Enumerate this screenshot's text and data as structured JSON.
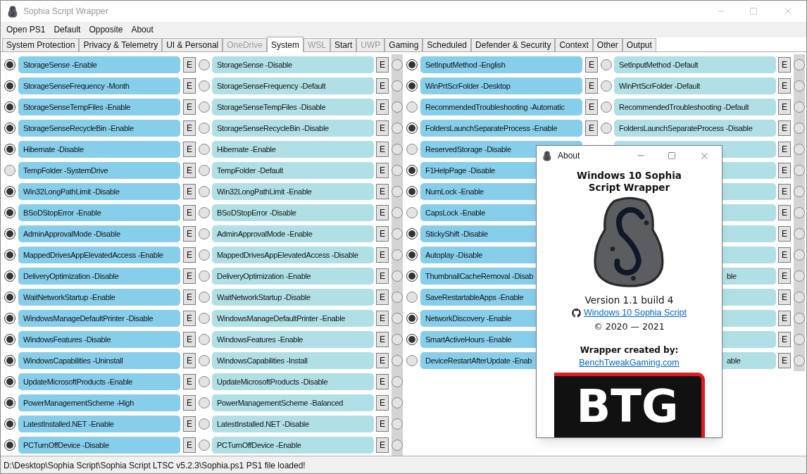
{
  "window": {
    "title": "Sophia Script Wrapper"
  },
  "menu": [
    "Open PS1",
    "Default",
    "Opposite",
    "About"
  ],
  "tabs": [
    {
      "label": "System Protection",
      "selected": false,
      "disabled": false
    },
    {
      "label": "Privacy & Telemetry",
      "selected": false,
      "disabled": false
    },
    {
      "label": "UI & Personal",
      "selected": false,
      "disabled": false
    },
    {
      "label": "OneDrive",
      "selected": false,
      "disabled": true
    },
    {
      "label": "System",
      "selected": true,
      "disabled": false
    },
    {
      "label": "WSL",
      "selected": false,
      "disabled": true
    },
    {
      "label": "Start",
      "selected": false,
      "disabled": false
    },
    {
      "label": "UWP",
      "selected": false,
      "disabled": true
    },
    {
      "label": "Gaming",
      "selected": false,
      "disabled": false
    },
    {
      "label": "Scheduled",
      "selected": false,
      "disabled": false
    },
    {
      "label": "Defender & Security",
      "selected": false,
      "disabled": false
    },
    {
      "label": "Context",
      "selected": false,
      "disabled": false
    },
    {
      "label": "Other",
      "selected": false,
      "disabled": false
    },
    {
      "label": "Output",
      "selected": false,
      "disabled": false
    }
  ],
  "rows_left": [
    {
      "option": {
        "label": "StorageSense -Enable",
        "selected": true,
        "edit": "E"
      },
      "opposite": {
        "label": "StorageSense -Disable",
        "selected": false,
        "edit": "E"
      },
      "extra": {
        "selected": false
      }
    },
    {
      "option": {
        "label": "StorageSenseFrequency -Month",
        "selected": true,
        "edit": "E"
      },
      "opposite": {
        "label": "StorageSenseFrequency -Default",
        "selected": false,
        "edit": "E"
      },
      "extra": {
        "selected": false
      }
    },
    {
      "option": {
        "label": "StorageSenseTempFiles -Enable",
        "selected": true,
        "edit": "E"
      },
      "opposite": {
        "label": "StorageSenseTempFiles -Disable",
        "selected": false,
        "edit": "E"
      },
      "extra": {
        "selected": false
      }
    },
    {
      "option": {
        "label": "StorageSenseRecycleBin -Enable",
        "selected": true,
        "edit": "E"
      },
      "opposite": {
        "label": "StorageSenseRecycleBin -Disable",
        "selected": false,
        "edit": "E"
      },
      "extra": {
        "selected": false
      }
    },
    {
      "option": {
        "label": "Hibernate -Disable",
        "selected": true,
        "edit": "E"
      },
      "opposite": {
        "label": "Hibernate -Enable",
        "selected": false,
        "edit": "E"
      },
      "extra": {
        "selected": false
      }
    },
    {
      "option": {
        "label": "TempFolder -SystemDrive",
        "selected": false,
        "edit": "E"
      },
      "opposite": {
        "label": "TempFolder -Default",
        "selected": false,
        "edit": "E"
      },
      "extra": {
        "selected": false
      }
    },
    {
      "option": {
        "label": "Win32LongPathLimit -Disable",
        "selected": true,
        "edit": "E"
      },
      "opposite": {
        "label": "Win32LongPathLimit -Enable",
        "selected": false,
        "edit": "E"
      },
      "extra": {
        "selected": false
      }
    },
    {
      "option": {
        "label": "BSoDStopError -Enable",
        "selected": true,
        "edit": "E"
      },
      "opposite": {
        "label": "BSoDStopError -Disable",
        "selected": false,
        "edit": "E"
      },
      "extra": {
        "selected": false
      }
    },
    {
      "option": {
        "label": "AdminApprovalMode -Disable",
        "selected": true,
        "edit": "E"
      },
      "opposite": {
        "label": "AdminApprovalMode -Enable",
        "selected": false,
        "edit": "E"
      },
      "extra": {
        "selected": false
      }
    },
    {
      "option": {
        "label": "MappedDrivesAppElevatedAccess -Enable",
        "selected": true,
        "edit": "E"
      },
      "opposite": {
        "label": "MappedDrivesAppElevatedAccess -Disable",
        "selected": false,
        "edit": "E"
      },
      "extra": {
        "selected": false
      }
    },
    {
      "option": {
        "label": "DeliveryOptimization -Disable",
        "selected": true,
        "edit": "E"
      },
      "opposite": {
        "label": "DeliveryOptimization -Enable",
        "selected": false,
        "edit": "E"
      },
      "extra": {
        "selected": false
      }
    },
    {
      "option": {
        "label": "WaitNetworkStartup -Enable",
        "selected": true,
        "edit": "E"
      },
      "opposite": {
        "label": "WaitNetworkStartup -Disable",
        "selected": false,
        "edit": "E"
      },
      "extra": {
        "selected": false
      }
    },
    {
      "option": {
        "label": "WindowsManageDefaultPrinter -Disable",
        "selected": true,
        "edit": "E"
      },
      "opposite": {
        "label": "WindowsManageDefaultPrinter -Enable",
        "selected": false,
        "edit": "E"
      },
      "extra": {
        "selected": false
      }
    },
    {
      "option": {
        "label": "WindowsFeatures -Disable",
        "selected": true,
        "edit": "E"
      },
      "opposite": {
        "label": "WindowsFeatures -Enable",
        "selected": false,
        "edit": "E"
      },
      "extra": {
        "selected": false
      }
    },
    {
      "option": {
        "label": "WindowsCapabilities -Uninstall",
        "selected": true,
        "edit": "E"
      },
      "opposite": {
        "label": "WindowsCapabilities -Install",
        "selected": false,
        "edit": "E"
      },
      "extra": {
        "selected": false
      }
    },
    {
      "option": {
        "label": "UpdateMicrosoftProducts -Enable",
        "selected": true,
        "edit": "E"
      },
      "opposite": {
        "label": "UpdateMicrosoftProducts -Disable",
        "selected": false,
        "edit": "E"
      },
      "extra": {
        "selected": false
      }
    },
    {
      "option": {
        "label": "PowerManagementScheme -High",
        "selected": true,
        "edit": "E"
      },
      "opposite": {
        "label": "PowerManagementScheme -Balanced",
        "selected": false,
        "edit": "E"
      },
      "extra": {
        "selected": false
      }
    },
    {
      "option": {
        "label": "LatestInstalled.NET -Enable",
        "selected": true,
        "edit": "E"
      },
      "opposite": {
        "label": "LatestInstalled.NET -Disable",
        "selected": false,
        "edit": "E"
      },
      "extra": {
        "selected": false
      }
    },
    {
      "option": {
        "label": "PCTurnOffDevice -Disable",
        "selected": true,
        "edit": "E"
      },
      "opposite": {
        "label": "PCTurnOffDevice -Enable",
        "selected": false,
        "edit": "E"
      },
      "extra": {
        "selected": false
      }
    }
  ],
  "rows_right": [
    {
      "option": {
        "label": "SetInputMethod -English",
        "selected": true,
        "edit": "E"
      },
      "opposite": {
        "label": "SetInputMethod -Default",
        "selected": false,
        "edit": "E"
      },
      "extra": {
        "selected": false
      }
    },
    {
      "option": {
        "label": "WinPrtScrFolder -Desktop",
        "selected": true,
        "edit": "E"
      },
      "opposite": {
        "label": "WinPrtScrFolder -Default",
        "selected": false,
        "edit": "E"
      },
      "extra": {
        "selected": false
      }
    },
    {
      "option": {
        "label": "RecommendedTroubleshooting -Automatic",
        "selected": false,
        "edit": "E"
      },
      "opposite": {
        "label": "RecommendedTroubleshooting -Default",
        "selected": false,
        "edit": "E"
      },
      "extra": {
        "selected": false
      }
    },
    {
      "option": {
        "label": "FoldersLaunchSeparateProcess -Enable",
        "selected": true,
        "edit": "E"
      },
      "opposite": {
        "label": "FoldersLaunchSeparateProcess -Disable",
        "selected": false,
        "edit": "E"
      },
      "extra": {
        "selected": false
      }
    },
    {
      "option": {
        "label": "ReservedStorage -Disable",
        "selected": false
      },
      "opposite": {
        "edit": "E"
      },
      "extra": {
        "selected": false
      }
    },
    {
      "option": {
        "label": "F1HelpPage -Disable",
        "selected": true
      },
      "opposite": {
        "edit": "E"
      },
      "extra": {
        "selected": false
      }
    },
    {
      "option": {
        "label": "NumLock -Enable",
        "selected": true
      },
      "opposite": {
        "edit": "E"
      },
      "extra": {
        "selected": false
      }
    },
    {
      "option": {
        "label": "CapsLock -Enable",
        "selected": false
      },
      "opposite": {
        "edit": "E"
      },
      "extra": {
        "selected": false
      }
    },
    {
      "option": {
        "label": "StickyShift -Disable",
        "selected": true
      },
      "opposite": {
        "edit": "E"
      },
      "extra": {
        "selected": false
      }
    },
    {
      "option": {
        "label": "Autoplay -Disable",
        "selected": true
      },
      "opposite": {
        "edit": "E"
      },
      "extra": {
        "selected": false
      }
    },
    {
      "option": {
        "label": "ThumbnailCacheRemoval -Disab",
        "selected": true
      },
      "opposite": {
        "label": "ble",
        "edit": "E"
      },
      "extra": {
        "selected": false
      }
    },
    {
      "option": {
        "label": "SaveRestartableApps -Enable",
        "selected": false
      },
      "opposite": {
        "edit": "E"
      },
      "extra": {
        "selected": false
      }
    },
    {
      "option": {
        "label": "NetworkDiscovery -Enable",
        "selected": true
      },
      "opposite": {
        "edit": "E"
      },
      "extra": {
        "selected": false
      }
    },
    {
      "option": {
        "label": "SmartActiveHours -Enable",
        "selected": true
      },
      "opposite": {
        "edit": "E"
      },
      "extra": {
        "selected": false
      }
    },
    {
      "option": {
        "label": "DeviceRestartAfterUpdate -Enab",
        "selected": false
      },
      "opposite": {
        "label": "able",
        "edit": "E"
      },
      "extra": {
        "selected": false
      }
    }
  ],
  "status_bar": "D:\\Desktop\\Sophia Script\\Sophia Script LTSC v5.2.3\\Sophia.ps1 PS1 file loaded!",
  "about_dialog": {
    "title": "About",
    "heading": "Windows 10 Sophia Script Wrapper",
    "version": "Version 1.1 build 4",
    "repo_link": "Windows 10 Sophia Script",
    "copyright": "© 2020 — 2021",
    "credit_label": "Wrapper created by:",
    "credit_link": "BenchTweakGaming.com",
    "logo_text": "BTG"
  }
}
